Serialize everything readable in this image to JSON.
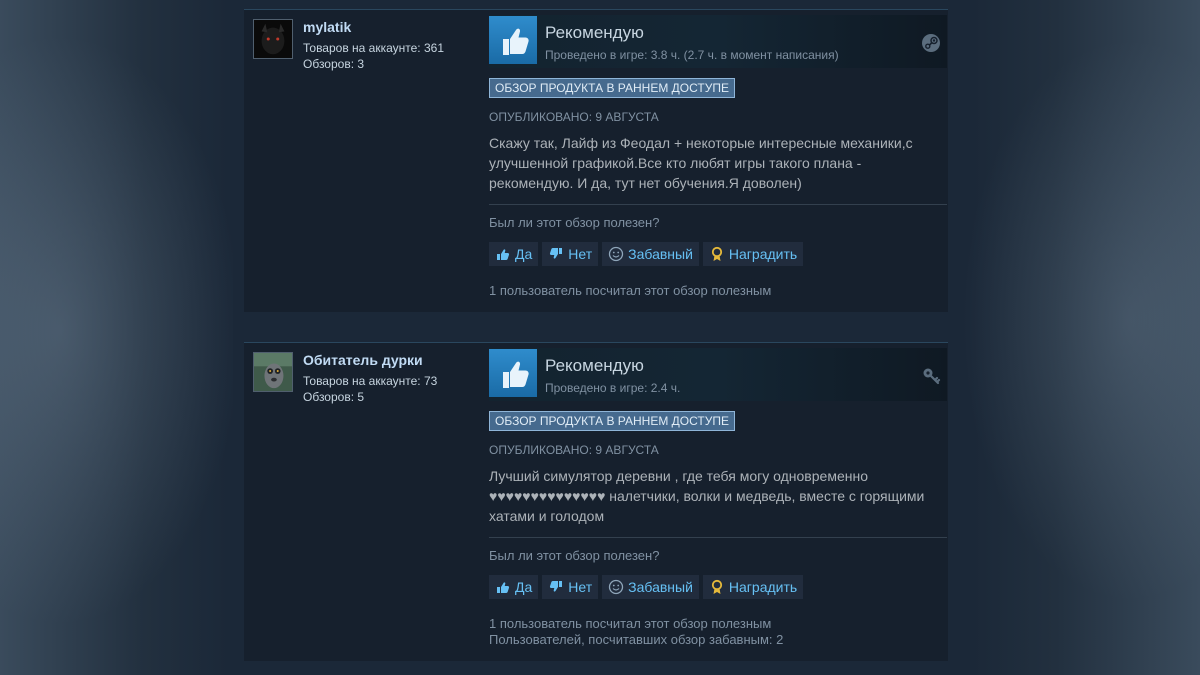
{
  "reviews": [
    {
      "author": {
        "name": "mylatik",
        "products_owned": "Товаров на аккаунте: 361",
        "reviews_count": "Обзоров: 3",
        "avatar_icon": "dark-creature-avatar"
      },
      "verdict": "Рекомендую",
      "verdict_icon": "thumbs-up-icon",
      "playtime": "Проведено в игре: 3.8 ч. (2.7 ч. в момент написания)",
      "source_icon": "steam-icon",
      "early_access_badge": "Обзор продукта в раннем доступе",
      "posted": "Опубликовано: 9 августа",
      "text": "Скажу так, Лайф из Феодал + некоторые интересные механики,с улучшенной графикой.Все кто любят игры такого плана - рекомендую. И да, тут нет обучения.Я доволен)",
      "helpful_question": "Был ли этот обзор полезен?",
      "buttons": {
        "yes": "Да",
        "no": "Нет",
        "funny": "Забавный",
        "award": "Наградить"
      },
      "footer": [
        "1 пользователь посчитал этот обзор полезным"
      ]
    },
    {
      "author": {
        "name": "Обитатель дурки",
        "products_owned": "Товаров на аккаунте: 73",
        "reviews_count": "Обзоров: 5",
        "avatar_icon": "lemur-avatar"
      },
      "verdict": "Рекомендую",
      "verdict_icon": "thumbs-up-icon",
      "playtime": "Проведено в игре: 2.4 ч.",
      "source_icon": "key-icon",
      "early_access_badge": "Обзор продукта в раннем доступе",
      "posted": "Опубликовано: 9 августа",
      "text": "Лучший симулятор деревни , где тебя могу одновременно ♥♥♥♥♥♥♥♥♥♥♥♥♥♥ налетчики, волки и медведь, вместе с горящими хатами и голодом",
      "helpful_question": "Был ли этот обзор полезен?",
      "buttons": {
        "yes": "Да",
        "no": "Нет",
        "funny": "Забавный",
        "award": "Наградить"
      },
      "footer": [
        "1 пользователь посчитал этот обзор полезным",
        "Пользователей, посчитавших обзор забавным: 2"
      ]
    }
  ],
  "colors": {
    "page_bg": "#1b2838",
    "card_bg": "#16202d",
    "accent_blue": "#66c0f4",
    "thumb_tile": "#2f8ccc",
    "badge_bg": "#466a8e",
    "award_gold": "#e5b93b"
  }
}
